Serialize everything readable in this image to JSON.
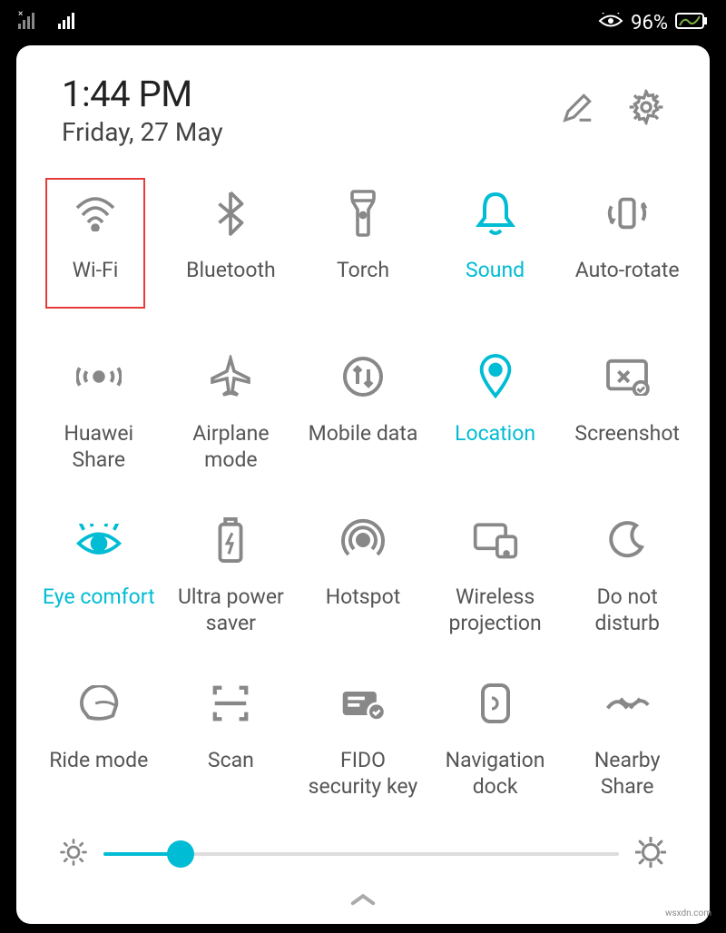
{
  "status": {
    "battery_pct": "96%"
  },
  "header": {
    "time": "1:44 PM",
    "date": "Friday, 27 May"
  },
  "tiles": [
    {
      "id": "wifi",
      "label": "Wi-Fi",
      "active": false,
      "highlight": true
    },
    {
      "id": "bluetooth",
      "label": "Bluetooth",
      "active": false
    },
    {
      "id": "torch",
      "label": "Torch",
      "active": false
    },
    {
      "id": "sound",
      "label": "Sound",
      "active": true
    },
    {
      "id": "autorotate",
      "label": "Auto-rotate",
      "active": false
    },
    {
      "id": "huaweishare",
      "label": "Huawei Share",
      "active": false
    },
    {
      "id": "airplane",
      "label": "Airplane mode",
      "active": false
    },
    {
      "id": "mobiledata",
      "label": "Mobile data",
      "active": false
    },
    {
      "id": "location",
      "label": "Location",
      "active": true
    },
    {
      "id": "screenshot",
      "label": "Screenshot",
      "active": false
    },
    {
      "id": "eyecomfort",
      "label": "Eye comfort",
      "active": true
    },
    {
      "id": "ultrapower",
      "label": "Ultra power saver",
      "active": false
    },
    {
      "id": "hotspot",
      "label": "Hotspot",
      "active": false
    },
    {
      "id": "wireless",
      "label": "Wireless projection",
      "active": false
    },
    {
      "id": "dnd",
      "label": "Do not disturb",
      "active": false
    },
    {
      "id": "ridemode",
      "label": "Ride mode",
      "active": false
    },
    {
      "id": "scan",
      "label": "Scan",
      "active": false
    },
    {
      "id": "fido",
      "label": "FIDO security key",
      "active": false
    },
    {
      "id": "navdock",
      "label": "Navigation dock",
      "active": false
    },
    {
      "id": "nearbyshare",
      "label": "Nearby Share",
      "active": false
    }
  ],
  "brightness_pct": 15,
  "colors": {
    "accent": "#00bcd4",
    "highlight_border": "#e63b3b",
    "icon_gray": "#888"
  },
  "watermark": "wsxdn.com"
}
